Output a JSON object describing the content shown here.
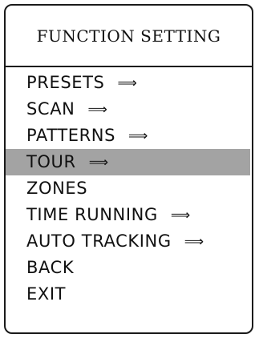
{
  "menu": {
    "title": "FUNCTION SETTING",
    "items": [
      {
        "label": "PRESETS",
        "arrow": "⟹",
        "selected": false
      },
      {
        "label": "SCAN",
        "arrow": "⟹",
        "selected": false
      },
      {
        "label": "PATTERNS",
        "arrow": "⟹",
        "selected": false
      },
      {
        "label": "TOUR",
        "arrow": "⟹",
        "selected": true
      },
      {
        "label": "ZONES",
        "arrow": "",
        "selected": false
      },
      {
        "label": "TIME RUNNING",
        "arrow": "⟹",
        "selected": false
      },
      {
        "label": "AUTO TRACKING",
        "arrow": "⟹",
        "selected": false
      },
      {
        "label": "BACK",
        "arrow": "",
        "selected": false
      },
      {
        "label": "EXIT",
        "arrow": "",
        "selected": false
      }
    ]
  },
  "colors": {
    "border": "#1a1a1a",
    "selected_background": "#a3a3a3",
    "text": "#111111"
  }
}
